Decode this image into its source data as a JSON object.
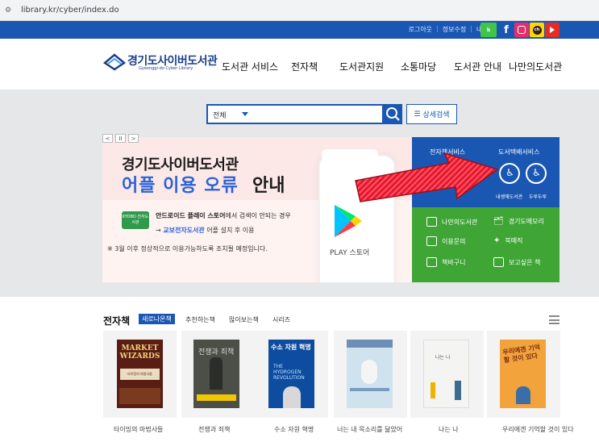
{
  "browser": {
    "url": "library.kr/cyber/index.do"
  },
  "utility": {
    "logout": "로그아웃",
    "edit_info": "정보수정",
    "my_library": "내서재"
  },
  "sns": [
    "blog",
    "f",
    "insta",
    "ch",
    "youtube"
  ],
  "logo": {
    "title": "경기도사이버도서관",
    "subtitle": "Gyeonggi-do Cyber Library"
  },
  "gnb": [
    "도서관 서비스",
    "전자책",
    "도서관지원",
    "소통마당",
    "도서관 안내",
    "나만의도서관"
  ],
  "search": {
    "select_value": "전체",
    "advanced_label": "상세검색"
  },
  "banner": {
    "title1": "경기도사이버도서관",
    "title2_colored": "어플 이용 오류",
    "title2_black": "안내",
    "kyobo_logo": "KYOBO 전자도서관",
    "line1_bold": "안드로이드 플레이 스토어",
    "line1_rest": "에서 검색이 안되는 경우",
    "line2_arrow": "→",
    "line2_blue": "교보전자도서관",
    "line2_rest": " 어플 설치 후 이용",
    "note": "※ 3월 이후 정상적으로 이용가능하도록 조치될 예정입니다.",
    "play_label": "PLAY 스토어",
    "controls": [
      "<",
      "II",
      ">"
    ]
  },
  "services": {
    "ebook_service": "전자책서비스",
    "delivery_service": "도서택배서비스",
    "delivery_cap1": "내생애도서관",
    "delivery_cap2": "두루두루",
    "items": [
      "나만의도서관",
      "경기도메모리",
      "이용문의",
      "북메직",
      "책바구니",
      "보고싶은 책"
    ]
  },
  "ebooks": {
    "title": "전자책",
    "tabs": [
      "새로나온책",
      "추천하는책",
      "많이보는책",
      "시리즈"
    ],
    "books": [
      {
        "title": "타이밍의 마법사들",
        "cover_top": "MARKET",
        "cover_bottom": "WIZARDS",
        "cover_sub": "타이밍의 마법사들"
      },
      {
        "title": "전쟁과 죄책",
        "cover_top": "전쟁과 죄책",
        "cover_bottom": "",
        "cover_sub": ""
      },
      {
        "title": "수소 자원 혁명",
        "cover_top": "수소 자원 혁명",
        "cover_bottom": "THE HYDROGEN REVOLUTION",
        "cover_sub": ""
      },
      {
        "title": "너는 내 목소리를 닮았어",
        "cover_top": "",
        "cover_bottom": "",
        "cover_sub": ""
      },
      {
        "title": "나는 나",
        "cover_top": "나는 나",
        "cover_bottom": "",
        "cover_sub": ""
      },
      {
        "title": "우리에겐 기억할 것이 있다",
        "cover_top": "우리에겐 기억할 것이 있다",
        "cover_bottom": "",
        "cover_sub": ""
      }
    ]
  },
  "colors": {
    "brand_blue": "#1a57b3",
    "green": "#3fa535",
    "arrow_red": "#e3182d"
  }
}
